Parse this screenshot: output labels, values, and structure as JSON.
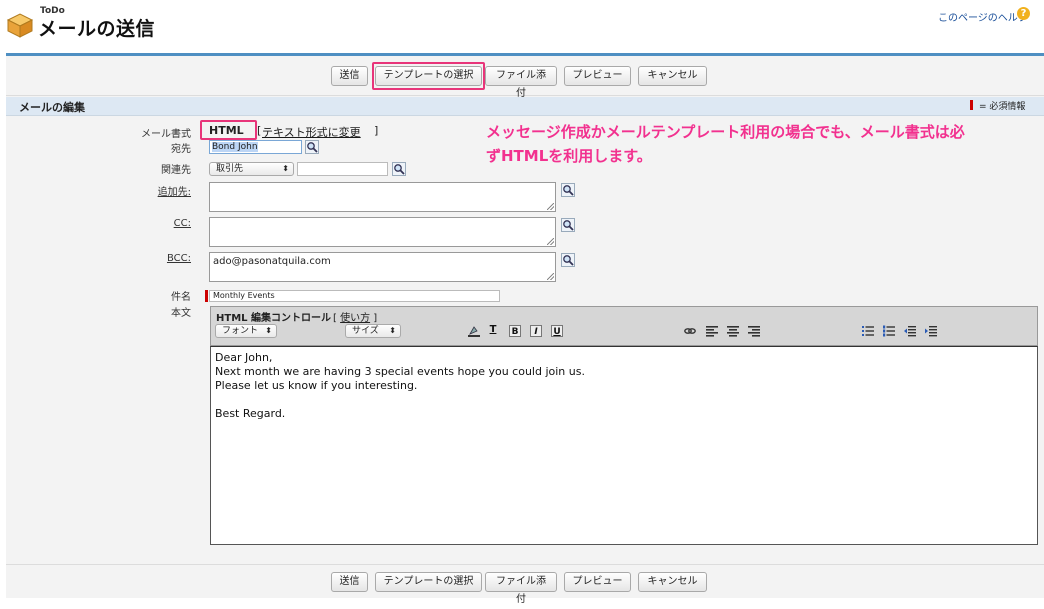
{
  "header": {
    "app_label": "ToDo",
    "title": "メールの送信",
    "help_link": "このページのヘルプ",
    "help_icon": "?"
  },
  "toolbar": {
    "send": "送信",
    "template": "テンプレートの選択",
    "attach": "ファイル添付",
    "preview": "プレビュー",
    "cancel": "キャンセル"
  },
  "section": {
    "title": "メールの編集",
    "required_legend": "= 必須情報"
  },
  "form": {
    "format_label": "メール書式",
    "format_value": "HTML",
    "format_switch": "テキスト形式に変更",
    "to_label": "宛先",
    "to_value": "Bond John",
    "related_label": "関連先",
    "related_select": "取引先",
    "additional_to_label": "追加先:",
    "cc_label": "CC:",
    "bcc_label": "BCC:",
    "bcc_value": "ado@pasonatquila.com",
    "subject_label": "件名",
    "subject_value": "Monthly Events",
    "body_label": "本文"
  },
  "editor": {
    "title": "HTML 編集コントロール",
    "how_to": "使い方",
    "font_select": "フォント",
    "size_select": "サイズ",
    "body_lines": [
      "Dear John,",
      "Next month we are having 3 special events hope you could join us.",
      "Please let us know if you interesting.",
      "",
      "Best Regard."
    ]
  },
  "annotation": {
    "line1": "メッセージ作成かメールテンプレート利用の場合でも、メール書式は必",
    "line2": "ずHTMLを利用します。"
  },
  "colors": {
    "accent_blue": "#4e8fc2",
    "highlight_pink": "#e8357a",
    "annotation_pink": "#f2318f",
    "required_red": "#cc0000"
  }
}
